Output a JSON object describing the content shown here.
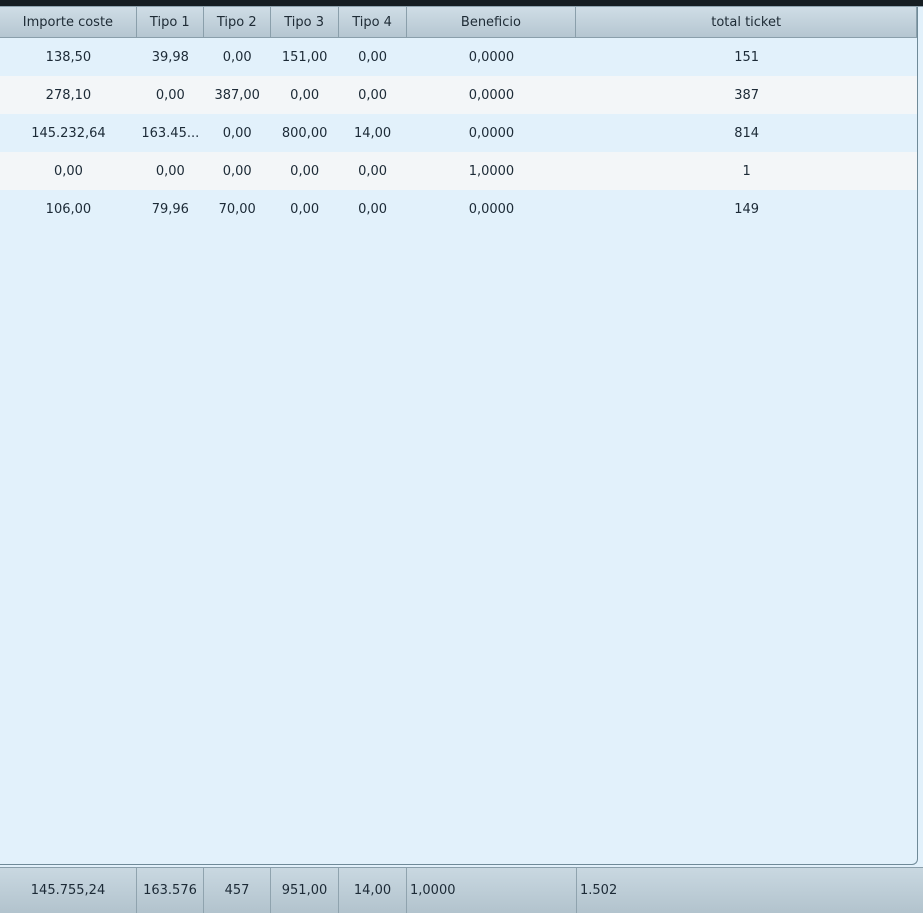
{
  "table": {
    "columns": [
      "Importe coste",
      "Tipo 1",
      "Tipo 2",
      "Tipo 3",
      "Tipo 4",
      "Beneficio",
      "total ticket"
    ],
    "rows": [
      [
        "138,50",
        "39,98",
        "0,00",
        "151,00",
        "0,00",
        "0,0000",
        "151"
      ],
      [
        "278,10",
        "0,00",
        "387,00",
        "0,00",
        "0,00",
        "0,0000",
        "387"
      ],
      [
        "145.232,64",
        "163.45...",
        "0,00",
        "800,00",
        "14,00",
        "0,0000",
        "814"
      ],
      [
        "0,00",
        "0,00",
        "0,00",
        "0,00",
        "0,00",
        "1,0000",
        "1"
      ],
      [
        "106,00",
        "79,96",
        "70,00",
        "0,00",
        "0,00",
        "0,0000",
        "149"
      ]
    ],
    "totals": [
      "145.755,24",
      "163.576",
      "457",
      "951,00",
      "14,00",
      "1,0000",
      "1.502"
    ]
  }
}
